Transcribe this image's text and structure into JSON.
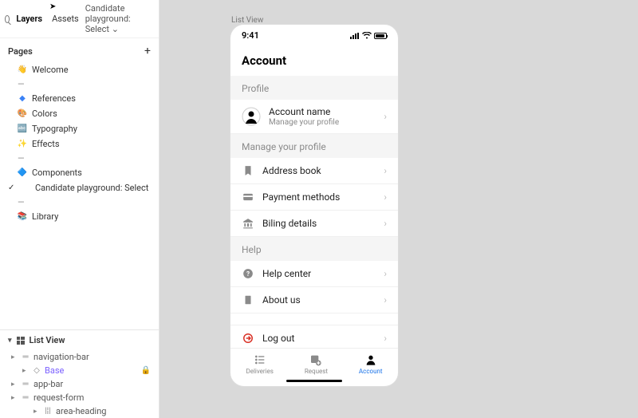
{
  "top": {
    "tab_layers": "Layers",
    "tab_assets": "Assets",
    "playground": "Candidate playground: Select"
  },
  "pages": {
    "header": "Pages",
    "items": [
      {
        "icon": "👋",
        "label": "Welcome"
      },
      {
        "icon": "—",
        "label": "",
        "divider": true
      },
      {
        "icon": "◆",
        "label": "References",
        "color": "#3b82f6"
      },
      {
        "icon": "🎨",
        "label": "Colors"
      },
      {
        "icon": "🔤",
        "label": "Typography"
      },
      {
        "icon": "✨",
        "label": "Effects"
      },
      {
        "icon": "—",
        "label": "",
        "divider": true
      },
      {
        "icon": "🔷",
        "label": "Components"
      },
      {
        "icon": "",
        "label": "Candidate playground: Select",
        "checked": true
      },
      {
        "icon": "—",
        "label": "",
        "divider": true
      },
      {
        "icon": "📚",
        "label": "Library"
      }
    ]
  },
  "layers": {
    "header": "List View",
    "tree": [
      {
        "name": "navigation-bar",
        "icon": "═",
        "indent": 0
      },
      {
        "name": "Base",
        "icon": "◇",
        "indent": 1,
        "selected": true,
        "locked": true
      },
      {
        "name": "app-bar",
        "icon": "═",
        "indent": 0
      },
      {
        "name": "request-form",
        "icon": "═",
        "indent": 0
      },
      {
        "name": "area-heading",
        "icon": "|¦|",
        "indent": 2
      }
    ]
  },
  "canvas_label": "List View",
  "phone": {
    "time": "9:41",
    "title": "Account",
    "groups": [
      {
        "header": "Profile",
        "rows": [
          {
            "type": "account",
            "title": "Account name",
            "sub": "Manage your profile"
          }
        ]
      },
      {
        "header": "Manage your profile",
        "rows": [
          {
            "icon": "bookmark",
            "title": "Address book"
          },
          {
            "icon": "card",
            "title": "Payment methods"
          },
          {
            "icon": "bank",
            "title": "Biling details"
          }
        ]
      },
      {
        "header": "Help",
        "rows": [
          {
            "icon": "help",
            "title": "Help center"
          },
          {
            "icon": "doc",
            "title": "About us"
          }
        ]
      }
    ],
    "logout": "Log out",
    "tabs": [
      {
        "icon": "list",
        "label": "Deliveries"
      },
      {
        "icon": "request",
        "label": "Request"
      },
      {
        "icon": "person",
        "label": "Account",
        "active": true
      }
    ]
  }
}
